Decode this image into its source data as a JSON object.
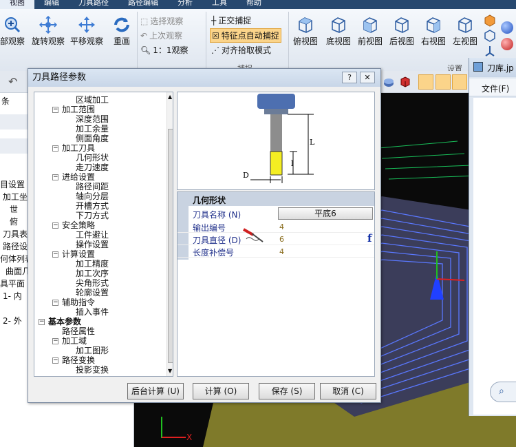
{
  "menu": [
    "视图",
    "编辑",
    "刀具路径",
    "路径编辑",
    "分析",
    "工具",
    "帮助"
  ],
  "ribbon": {
    "zoom": "部观察",
    "rotate": "旋转观察",
    "pan": "平移观察",
    "redraw": "重画",
    "select_view": "选择观察",
    "last_view": "上次观察",
    "one_to_one": "1：1观察",
    "ortho": "正交捕捉",
    "feature_snap": "特征点自动捕捉",
    "align_snap": "对齐拾取模式",
    "snap_group": "捕捉",
    "views": [
      "俯视图",
      "底视图",
      "前视图",
      "后视图",
      "右视图",
      "左视图"
    ],
    "settings_group": "设置"
  },
  "left_panel": [
    "条",
    "目设置",
    "加工坐",
    "世",
    "俯",
    "刀具表",
    "路径设",
    "何体列表",
    "曲面几",
    "具平面",
    "1- 内",
    "2- 外"
  ],
  "dialog": {
    "title": "刀具路径参数",
    "help": "?",
    "close": "✕",
    "tree": [
      {
        "label": "区域加工",
        "level": 2
      },
      {
        "label": "加工范围",
        "level": 1,
        "box": "−"
      },
      {
        "label": "深度范围",
        "level": 2
      },
      {
        "label": "加工余量",
        "level": 2
      },
      {
        "label": "侧面角度",
        "level": 2
      },
      {
        "label": "加工刀具",
        "level": 1,
        "box": "−"
      },
      {
        "label": "几何形状",
        "level": 2
      },
      {
        "label": "走刀速度",
        "level": 2
      },
      {
        "label": "进给设置",
        "level": 1,
        "box": "−"
      },
      {
        "label": "路径间距",
        "level": 2
      },
      {
        "label": "轴向分层",
        "level": 2
      },
      {
        "label": "开槽方式",
        "level": 2
      },
      {
        "label": "下刀方式",
        "level": 2
      },
      {
        "label": "安全策略",
        "level": 1,
        "box": "−"
      },
      {
        "label": "工件避让",
        "level": 2
      },
      {
        "label": "操作设置",
        "level": 2
      },
      {
        "label": "计算设置",
        "level": 1,
        "box": "−"
      },
      {
        "label": "加工精度",
        "level": 2
      },
      {
        "label": "加工次序",
        "level": 2
      },
      {
        "label": "尖角形式",
        "level": 2
      },
      {
        "label": "轮廓设置",
        "level": 2
      },
      {
        "label": "辅助指令",
        "level": 1,
        "box": "−"
      },
      {
        "label": "插入事件",
        "level": 2
      },
      {
        "label": "基本参数",
        "level": 0,
        "box": "−",
        "bold": true
      },
      {
        "label": "路径属性",
        "level": 1
      },
      {
        "label": "加工域",
        "level": 1,
        "box": "−"
      },
      {
        "label": "加工图形",
        "level": 2
      },
      {
        "label": "路径变换",
        "level": 1,
        "box": "−"
      },
      {
        "label": "投影变换",
        "level": 2
      }
    ],
    "preview": {
      "L": "L",
      "l": "l",
      "D": "D"
    },
    "props": {
      "header": "几何形状",
      "rows": [
        {
          "key": "刀具名称 (N)",
          "value": "平底6",
          "button": true
        },
        {
          "key": "输出编号",
          "value": "4"
        },
        {
          "key": "刀具直径 (D)",
          "value": "6"
        },
        {
          "key": "长度补偿号",
          "value": "4"
        }
      ],
      "fx": "f"
    },
    "buttons": {
      "bg": "后台计算 (U)",
      "calc": "计算 (O)",
      "save": "保存 (S)",
      "cancel": "取消 (C)"
    }
  },
  "right_window": {
    "title": "刀库.jp",
    "menu": "文件(F)"
  },
  "axis": {
    "x": "X"
  }
}
